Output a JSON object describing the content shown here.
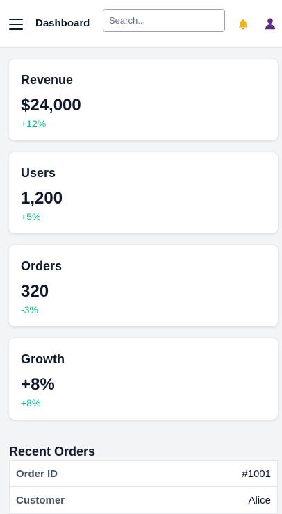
{
  "header": {
    "title": "Dashboard",
    "search_placeholder": "Search...",
    "menu_icon": "hamburger-menu-icon",
    "bell_icon": "bell-icon",
    "user_icon": "user-icon",
    "bell_color": "#f5b21b",
    "user_color": "#5b2a86"
  },
  "accent_positive": "#10b981",
  "cards": [
    {
      "title": "Revenue",
      "value": "$24,000",
      "change": "+12%"
    },
    {
      "title": "Users",
      "value": "1,200",
      "change": "+5%"
    },
    {
      "title": "Orders",
      "value": "320",
      "change": "-3%"
    },
    {
      "title": "Growth",
      "value": "+8%",
      "change": "+8%"
    }
  ],
  "recent_orders": {
    "title": "Recent Orders",
    "rows": [
      {
        "label": "Order ID",
        "value": "#1001"
      },
      {
        "label": "Customer",
        "value": "Alice"
      }
    ]
  }
}
